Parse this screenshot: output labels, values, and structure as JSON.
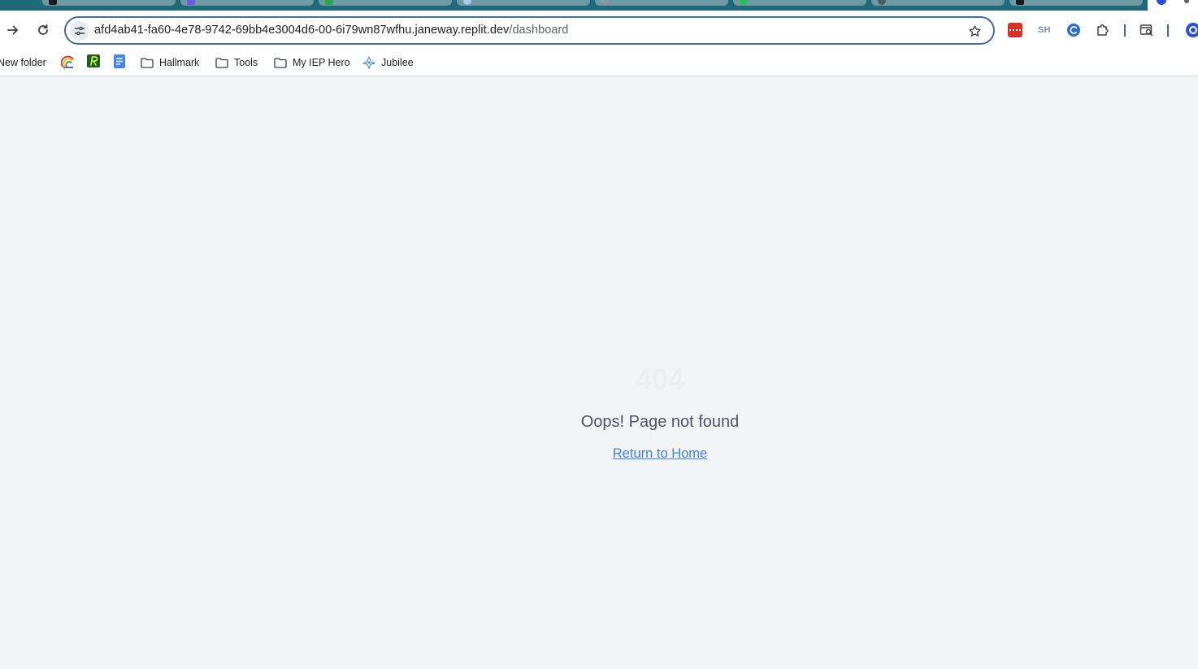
{
  "browser": {
    "url": {
      "host": "afd4ab41-fa60-4e78-9742-69bb4e3004d6-00-6i79wn87wfhu.janeway.replit.dev",
      "path": "/dashboard"
    },
    "tab_strip_color": "#1f6a78",
    "omnibox_border_color": "#3f6bb0",
    "extensions": [
      {
        "name": "password-manager-extension-icon",
        "color": "#d93025"
      },
      {
        "name": "sh-extension",
        "label": "SH"
      },
      {
        "name": "grammar-extension-icon",
        "color": "#2b6bd9"
      },
      {
        "name": "puzzle-extensions-icon"
      },
      {
        "name": "tab-search-icon"
      },
      {
        "name": "profile-avatar-icon",
        "color": "#2b4fd9"
      }
    ]
  },
  "bookmarks": {
    "items": [
      {
        "label": "New folder",
        "icon": "folder-icon"
      },
      {
        "label": "",
        "icon": "rainbow-app-icon"
      },
      {
        "label": "",
        "icon": "green-r-app-icon"
      },
      {
        "label": "",
        "icon": "google-docs-icon"
      },
      {
        "label": "Hallmark",
        "icon": "folder-icon"
      },
      {
        "label": "Tools",
        "icon": "folder-icon"
      },
      {
        "label": "My IEP Hero",
        "icon": "folder-icon"
      },
      {
        "label": "Jubilee",
        "icon": "jubilee-icon"
      }
    ]
  },
  "page": {
    "code": "404",
    "message": "Oops! Page not found",
    "link_label": "Return to Home",
    "link_color": "#3b82f6",
    "background": "#f3f4f6"
  }
}
